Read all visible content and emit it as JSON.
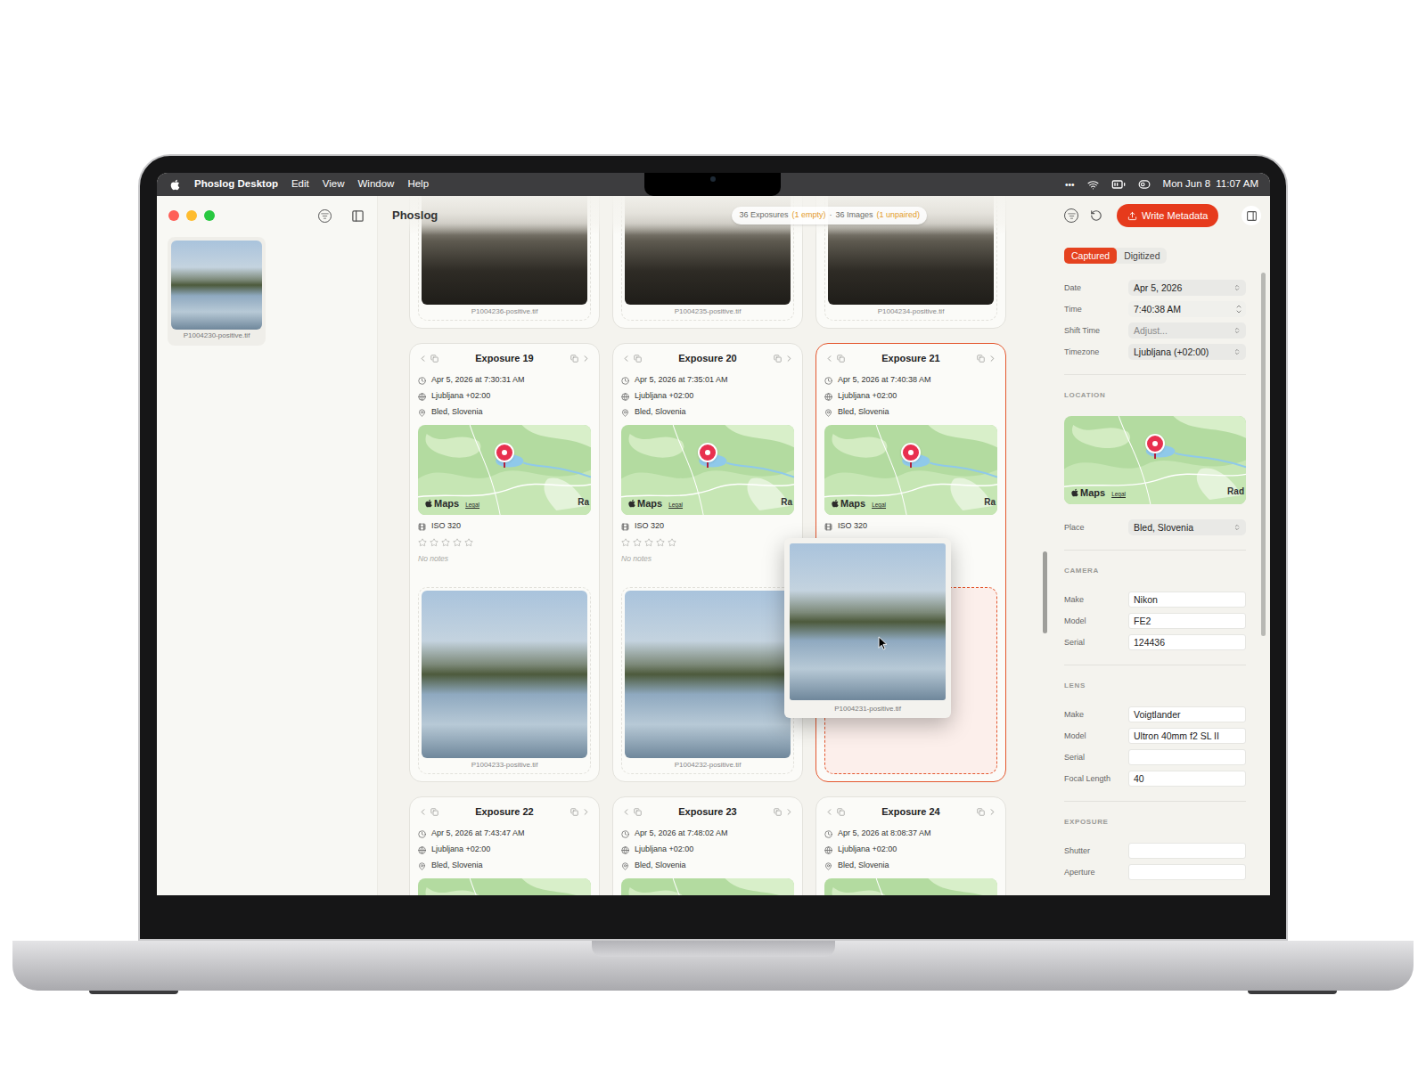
{
  "menu_bar": {
    "app": "Phoslog Desktop",
    "items": [
      "Edit",
      "View",
      "Window",
      "Help"
    ],
    "overflow": "•••",
    "date": "Mon Jun 8",
    "time": "11:07 AM"
  },
  "sidebar": {
    "images": [
      {
        "file": "P1004230-positive.tif",
        "kind": "sunny"
      }
    ]
  },
  "toolbar": {
    "title": "Phoslog",
    "summary": [
      {
        "text": "36 Exposures",
        "highlight": false
      },
      {
        "text": "(1 empty)",
        "highlight": true
      },
      {
        "text": "·",
        "highlight": false
      },
      {
        "text": "36 Images",
        "highlight": false
      },
      {
        "text": "(1 unpaired)",
        "highlight": true
      }
    ]
  },
  "partial_row": [
    {
      "file": "P1004236-positive.tif",
      "kind": "foggy"
    },
    {
      "file": "P1004235-positive.tif",
      "kind": "foggy"
    },
    {
      "file": "P1004234-positive.tif",
      "kind": "foggy"
    }
  ],
  "exposures": [
    {
      "title": "Exposure 19",
      "selected": false,
      "date": "Apr 5, 2026 at 7:30:31 AM",
      "timezone": "Ljubljana +02:00",
      "place": "Bled, Slovenia",
      "map": {
        "attribution": "Maps",
        "legal": "Legal",
        "label": "Ra"
      },
      "film": "ISO 320",
      "stars": 0,
      "notes": "No notes",
      "drop_target": false,
      "image": {
        "file": "P1004233-positive.tif",
        "kind": "sunny"
      }
    },
    {
      "title": "Exposure 20",
      "selected": false,
      "date": "Apr 5, 2026 at 7:35:01 AM",
      "timezone": "Ljubljana +02:00",
      "place": "Bled, Slovenia",
      "map": {
        "attribution": "Maps",
        "legal": "Legal",
        "label": "Ra"
      },
      "film": "ISO 320",
      "stars": 0,
      "notes": "No notes",
      "drop_target": false,
      "image": {
        "file": "P1004232-positive.tif",
        "kind": "sunny"
      }
    },
    {
      "title": "Exposure 21",
      "selected": true,
      "date": "Apr 5, 2026 at 7:40:38 AM",
      "timezone": "Ljubljana +02:00",
      "place": "Bled, Slovenia",
      "map": {
        "attribution": "Maps",
        "legal": "Legal",
        "label": "Ra"
      },
      "film": "ISO 320",
      "stars": 0,
      "notes": null,
      "drop_target": true,
      "image": null
    },
    {
      "title": "Exposure 22",
      "selected": false,
      "date": "Apr 5, 2026 at 7:43:47 AM",
      "timezone": "Ljubljana +02:00",
      "place": "Bled, Slovenia",
      "map": {}
    },
    {
      "title": "Exposure 23",
      "selected": false,
      "date": "Apr 5, 2026 at 7:48:02 AM",
      "timezone": "Ljubljana +02:00",
      "place": "Bled, Slovenia",
      "map": {}
    },
    {
      "title": "Exposure 24",
      "selected": false,
      "date": "Apr 5, 2026 at 8:08:37 AM",
      "timezone": "Ljubljana +02:00",
      "place": "Bled, Slovenia",
      "map": {}
    }
  ],
  "drag": {
    "file": "P1004231-positive.tif",
    "kind": "sunny"
  },
  "inspector": {
    "write_button": "Write Metadata",
    "tabs": [
      {
        "label": "Captured",
        "selected": true
      },
      {
        "label": "Digitized",
        "selected": false
      }
    ],
    "sections": [
      {
        "title": null,
        "map": null,
        "fields": [
          {
            "label": "Date",
            "value": "Apr 5, 2026",
            "kind": "select",
            "placeholder": false
          },
          {
            "label": "Time",
            "value": "7:40:38 AM",
            "kind": "stepper",
            "placeholder": false
          },
          {
            "label": "Shift Time",
            "value": "Adjust...",
            "kind": "select",
            "placeholder": true
          },
          {
            "label": "Timezone",
            "value": "Ljubljana (+02:00)",
            "kind": "select",
            "placeholder": false
          }
        ]
      },
      {
        "title": "LOCATION",
        "map": {
          "attribution": "Maps",
          "legal": "Legal",
          "label": "Rad"
        },
        "fields": [
          {
            "label": "Place",
            "value": "Bled, Slovenia",
            "kind": "select",
            "placeholder": false
          }
        ]
      },
      {
        "title": "CAMERA",
        "map": null,
        "fields": [
          {
            "label": "Make",
            "value": "Nikon",
            "kind": "text",
            "placeholder": false
          },
          {
            "label": "Model",
            "value": "FE2",
            "kind": "text",
            "placeholder": false
          },
          {
            "label": "Serial",
            "value": "124436",
            "kind": "text",
            "placeholder": false
          }
        ]
      },
      {
        "title": "LENS",
        "map": null,
        "fields": [
          {
            "label": "Make",
            "value": "Voigtlander",
            "kind": "text",
            "placeholder": false
          },
          {
            "label": "Model",
            "value": "Ultron 40mm f2 SL II",
            "kind": "text",
            "placeholder": false
          },
          {
            "label": "Serial",
            "value": "",
            "kind": "text",
            "placeholder": false
          },
          {
            "label": "Focal Length",
            "value": "40",
            "kind": "text",
            "placeholder": false
          }
        ]
      },
      {
        "title": "EXPOSURE",
        "map": null,
        "fields": [
          {
            "label": "Shutter",
            "value": "",
            "kind": "text",
            "placeholder": false
          },
          {
            "label": "Aperture",
            "value": "",
            "kind": "text",
            "placeholder": false
          }
        ]
      }
    ]
  }
}
